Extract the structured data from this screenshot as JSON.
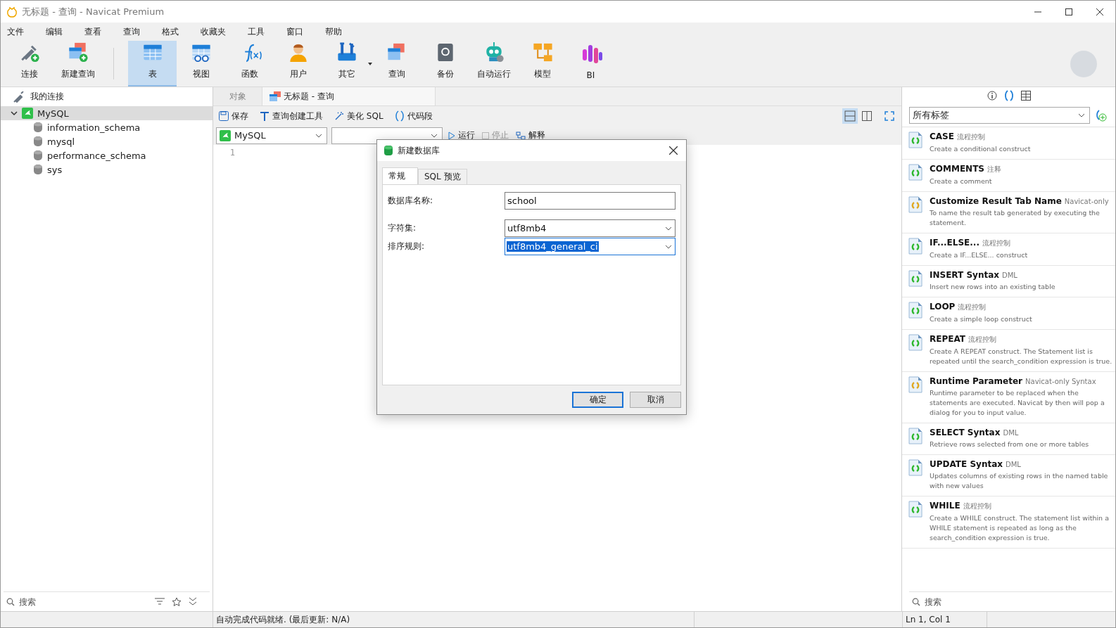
{
  "window": {
    "title": "无标题 - 查询 - Navicat Premium"
  },
  "menu": [
    "文件",
    "编辑",
    "查看",
    "查询",
    "格式",
    "收藏夹",
    "工具",
    "窗口",
    "帮助"
  ],
  "toolbar": [
    {
      "label": "连接",
      "selected": false
    },
    {
      "label": "新建查询",
      "selected": false
    },
    {
      "label": "表",
      "selected": true
    },
    {
      "label": "视图",
      "selected": false
    },
    {
      "label": "函数",
      "selected": false
    },
    {
      "label": "用户",
      "selected": false
    },
    {
      "label": "其它",
      "selected": false
    },
    {
      "label": "查询",
      "selected": false
    },
    {
      "label": "备份",
      "selected": false
    },
    {
      "label": "自动运行",
      "selected": false
    },
    {
      "label": "模型",
      "selected": false
    },
    {
      "label": "BI",
      "selected": false
    }
  ],
  "sidebar": {
    "header": "我的连接",
    "tree": [
      {
        "label": "MySQL",
        "expanded": true,
        "selected": true,
        "children": [
          {
            "label": "information_schema"
          },
          {
            "label": "mysql"
          },
          {
            "label": "performance_schema"
          },
          {
            "label": "sys"
          }
        ]
      }
    ],
    "search": {
      "placeholder": "搜索"
    }
  },
  "tabs": [
    {
      "label": "对象",
      "selected": false
    },
    {
      "label": "无标题 - 查询",
      "selected": true
    }
  ],
  "query_toolbar": [
    "保存",
    "查询创建工具",
    "美化 SQL",
    "代码段"
  ],
  "connection_select": "MySQL",
  "run_toolbar": [
    "运行",
    "停止",
    "解释"
  ],
  "editor": {
    "line_numbers": [
      "1"
    ]
  },
  "dialog": {
    "title": "新建数据库",
    "tabs": [
      {
        "label": "常规",
        "selected": true
      },
      {
        "label": "SQL 预览",
        "selected": false
      }
    ],
    "fields": [
      {
        "label": "数据库名称:",
        "value": "school",
        "kind": "text"
      },
      {
        "label": "字符集:",
        "value": "utf8mb4",
        "kind": "select"
      },
      {
        "label": "排序规则:",
        "value": "utf8mb4_general_ci",
        "kind": "select",
        "focused": true
      }
    ],
    "buttons": [
      {
        "label": "确定",
        "default": true
      },
      {
        "label": "取消",
        "default": false
      }
    ]
  },
  "snippets": {
    "filter": "所有标签",
    "search": {
      "placeholder": "搜索"
    },
    "items": [
      {
        "title": "CASE",
        "tag": "流程控制",
        "description": "Create a conditional construct",
        "color": "#2eb82e"
      },
      {
        "title": "COMMENTS",
        "tag": "注释",
        "description": "Create a comment",
        "color": "#2eb82e"
      },
      {
        "title": "Customize Result Tab Name",
        "tag": "Navicat-only",
        "description": "To name the result tab generated by executing the statement.",
        "color": "#e0a820"
      },
      {
        "title": "IF...ELSE...",
        "tag": "流程控制",
        "description": "Create a IF...ELSE... construct",
        "color": "#2eb82e"
      },
      {
        "title": "INSERT Syntax",
        "tag": "DML",
        "description": "Insert new rows into an existing table",
        "color": "#2eb82e"
      },
      {
        "title": "LOOP",
        "tag": "流程控制",
        "description": "Create a simple loop construct",
        "color": "#2eb82e"
      },
      {
        "title": "REPEAT",
        "tag": "流程控制",
        "description": "Create A REPEAT construct. The Statement list is repeated until the search_condition expression is true.",
        "color": "#2eb82e"
      },
      {
        "title": "Runtime Parameter",
        "tag": "Navicat-only Syntax",
        "description": "Runtime parameter to be replaced when the statements are executed. Navicat by then will pop a dialog for you to input value.",
        "color": "#e0a820"
      },
      {
        "title": "SELECT Syntax",
        "tag": "DML",
        "description": "Retrieve rows selected from one or more tables",
        "color": "#2eb82e"
      },
      {
        "title": "UPDATE Syntax",
        "tag": "DML",
        "description": "Updates columns of existing rows in the named table with new values",
        "color": "#2eb82e"
      },
      {
        "title": "WHILE",
        "tag": "流程控制",
        "description": "Create a WHILE construct. The statement list within a WHILE statement is repeated as long as the search_condition expression is true.",
        "color": "#2eb82e"
      }
    ]
  },
  "status_bar": {
    "message": "自动完成代码就绪. (最后更新: N/A)",
    "position": "Ln 1, Col 1"
  }
}
